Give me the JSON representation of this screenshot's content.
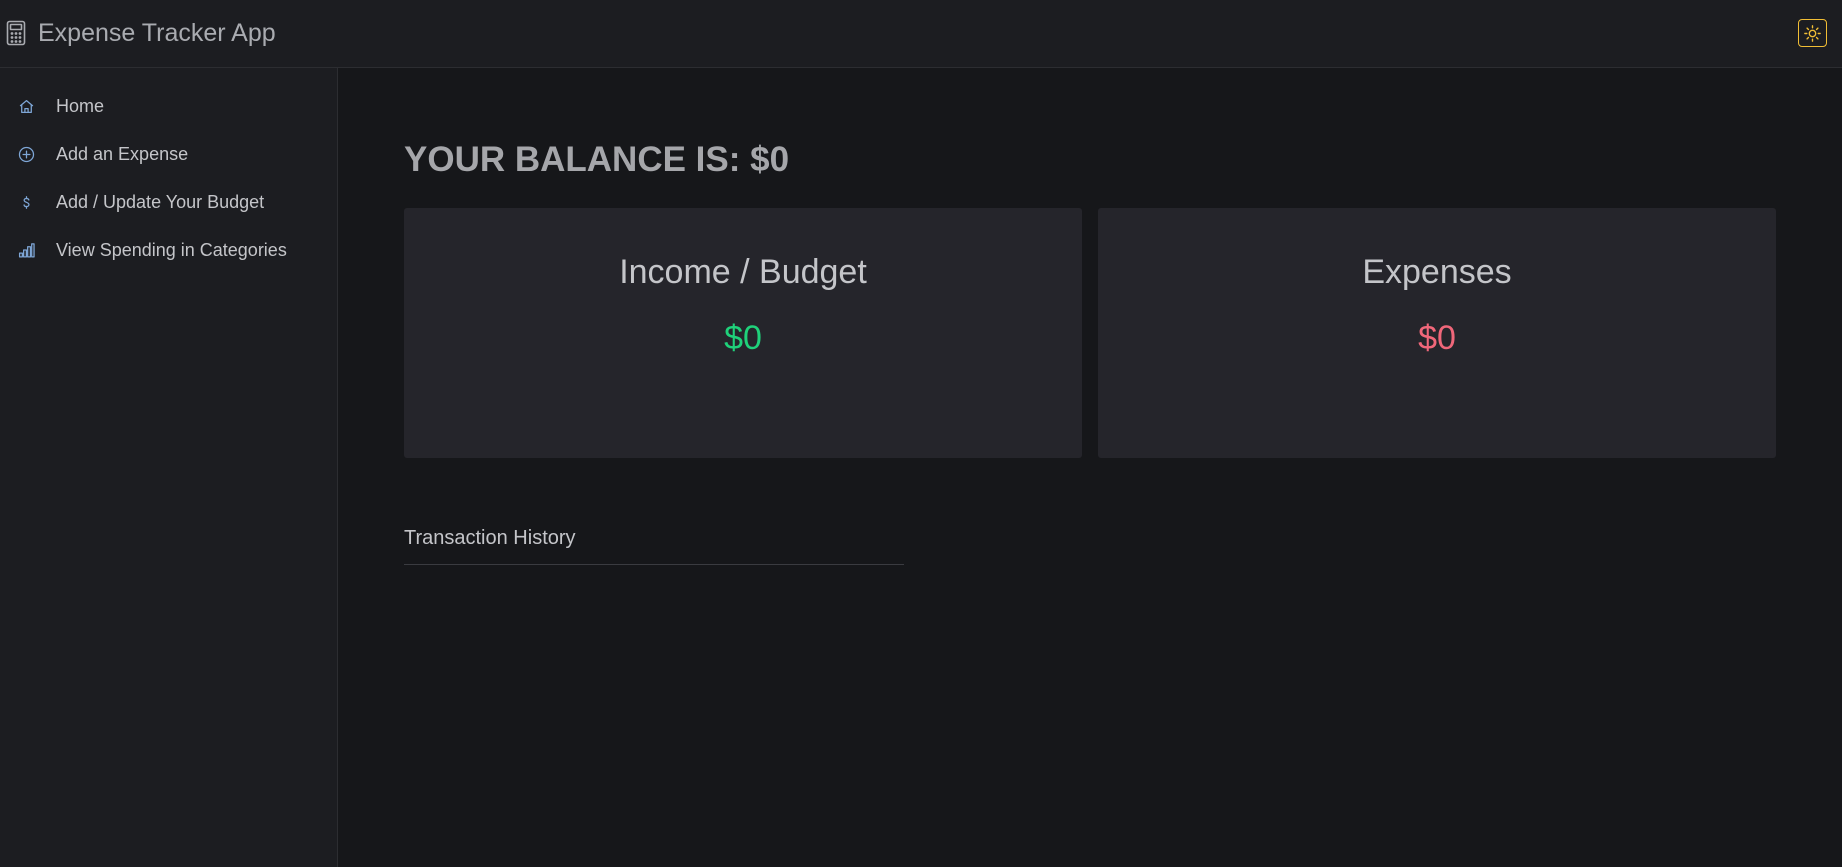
{
  "header": {
    "title": "Expense Tracker App",
    "brand_icon": "calculator-icon",
    "theme_toggle_icon": "sun-icon"
  },
  "sidebar": {
    "items": [
      {
        "label": "Home",
        "icon": "home-icon"
      },
      {
        "label": "Add an Expense",
        "icon": "plus-circle-icon"
      },
      {
        "label": "Add / Update Your Budget",
        "icon": "dollar-icon"
      },
      {
        "label": "View Spending in Categories",
        "icon": "bar-chart-icon"
      }
    ]
  },
  "main": {
    "balance_text": "YOUR BALANCE IS: $0",
    "income_card": {
      "title": "Income / Budget",
      "amount": "$0"
    },
    "expenses_card": {
      "title": "Expenses",
      "amount": "$0"
    },
    "history_title": "Transaction History"
  },
  "colors": {
    "accent_icon": "#7ea6d6",
    "income_green": "#1fd17a",
    "expense_red": "#f0677a",
    "theme_toggle_yellow": "#f1be35"
  }
}
